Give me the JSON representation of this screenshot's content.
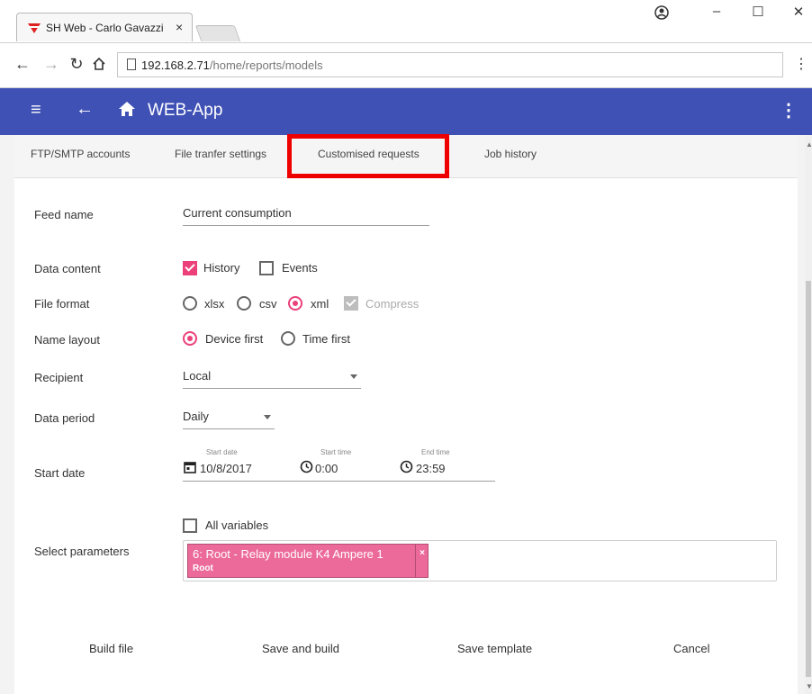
{
  "browser": {
    "tab_title": "SH Web - Carlo Gavazzi",
    "tab_close": "×",
    "url_host": "192.168.2.71",
    "url_path": "/home/reports/models",
    "window_controls": {
      "minimize": "–",
      "maximize": "☐",
      "close": "✕"
    },
    "menu_glyph": "⋮"
  },
  "appbar": {
    "menu_glyph": "≡",
    "back_glyph": "←",
    "title": "WEB-App",
    "more_glyph": "⋮",
    "color": "#3f51b5"
  },
  "tabs": [
    {
      "label": "FTP/SMTP accounts"
    },
    {
      "label": "File tranfer settings"
    },
    {
      "label": "Customised requests"
    },
    {
      "label": "Job history"
    }
  ],
  "form": {
    "feed_name": {
      "label": "Feed name",
      "value": "Current consumption"
    },
    "data_content": {
      "label": "Data content",
      "history": {
        "label": "History",
        "checked": true
      },
      "events": {
        "label": "Events",
        "checked": false
      }
    },
    "file_format": {
      "label": "File format",
      "options": [
        {
          "label": "xlsx",
          "selected": false
        },
        {
          "label": "csv",
          "selected": false
        },
        {
          "label": "xml",
          "selected": true
        }
      ],
      "compress": {
        "label": "Compress",
        "checked": true,
        "disabled": true
      }
    },
    "name_layout": {
      "label": "Name layout",
      "options": [
        {
          "label": "Device first",
          "selected": true
        },
        {
          "label": "Time first",
          "selected": false
        }
      ]
    },
    "recipient": {
      "label": "Recipient",
      "value": "Local"
    },
    "data_period": {
      "label": "Data period",
      "value": "Daily"
    },
    "start_date": {
      "label": "Start date",
      "date_caption": "Start date",
      "date_value": "10/8/2017",
      "start_time_caption": "Start time",
      "start_time_value": "0:00",
      "end_time_caption": "End time",
      "end_time_value": "23:59"
    },
    "all_variables": {
      "label": "All variables",
      "checked": false
    },
    "select_parameters": {
      "label": "Select parameters",
      "chips": [
        {
          "main": "6: Root - Relay module K4 Ampere 1",
          "sub": "Root",
          "remove": "×"
        }
      ]
    }
  },
  "actions": {
    "build_file": "Build file",
    "save_and_build": "Save and build",
    "save_template": "Save template",
    "cancel": "Cancel"
  },
  "colors": {
    "accent": "#ec407a",
    "highlight_box": "#ee0000"
  }
}
